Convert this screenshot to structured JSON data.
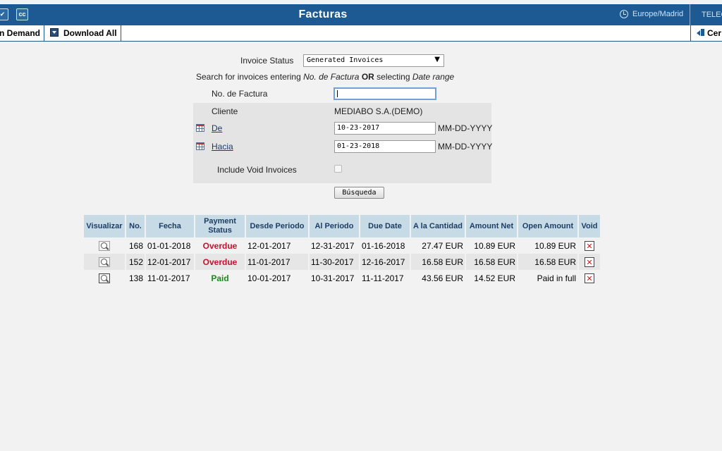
{
  "topbar": {
    "title": "Facturas",
    "timezone": "Europe/Madrid",
    "user_label": "TELEC",
    "check_button": "✔",
    "cc_button": "cc"
  },
  "toolbar": {
    "on_demand_label": "n Demand",
    "download_all_label": "Download All",
    "right_label": "Cer"
  },
  "form": {
    "invoice_status_label": "Invoice Status",
    "invoice_status_value": "Generated Invoices",
    "hint_prefix": "Search for invoices entering ",
    "hint_field": "No. de Factura",
    "hint_or": "OR",
    "hint_middle": " selecting ",
    "hint_range": "Date range",
    "invoice_no_label": "No. de Factura",
    "invoice_no_value": "",
    "client_label": "Cliente",
    "client_value": "MEDIABO S.A.(DEMO)",
    "from_label": "De",
    "from_value": "10-23-2017",
    "to_label": "Hacia",
    "to_value": "01-23-2018",
    "date_format": "MM-DD-YYYY",
    "include_void_label": "Include Void Invoices",
    "include_void_checked": false,
    "search_button": "Búsqueda"
  },
  "table": {
    "headers": {
      "view": "Visualizar",
      "no": "No.",
      "date": "Fecha",
      "payment_status_1": "Payment",
      "payment_status_2": "Status",
      "from_period": "Desde Periodo",
      "to_period": "Al Periodo",
      "due_date": "Due Date",
      "amount": "A la Cantidad",
      "amount_net": "Amount Net",
      "open_amount": "Open Amount",
      "void": "Void"
    },
    "rows": [
      {
        "no": "168",
        "date": "01-01-2018",
        "status": "Overdue",
        "from": "12-01-2017",
        "to": "12-31-2017",
        "due": "01-16-2018",
        "amount": "27.47 EUR",
        "net": "10.89 EUR",
        "open": "10.89 EUR"
      },
      {
        "no": "152",
        "date": "12-01-2017",
        "status": "Overdue",
        "from": "11-01-2017",
        "to": "11-30-2017",
        "due": "12-16-2017",
        "amount": "16.58 EUR",
        "net": "16.58 EUR",
        "open": "16.58 EUR"
      },
      {
        "no": "138",
        "date": "11-01-2017",
        "status": "Paid",
        "from": "10-01-2017",
        "to": "10-31-2017",
        "due": "11-11-2017",
        "amount": "43.56 EUR",
        "net": "14.52 EUR",
        "open": "Paid in full"
      }
    ],
    "void_glyph": "✕"
  },
  "colors": {
    "header_bg": "#1d5a94",
    "table_header_bg": "#c6dbe5",
    "overdue": "#c8102e",
    "paid": "#1c8a1c"
  }
}
